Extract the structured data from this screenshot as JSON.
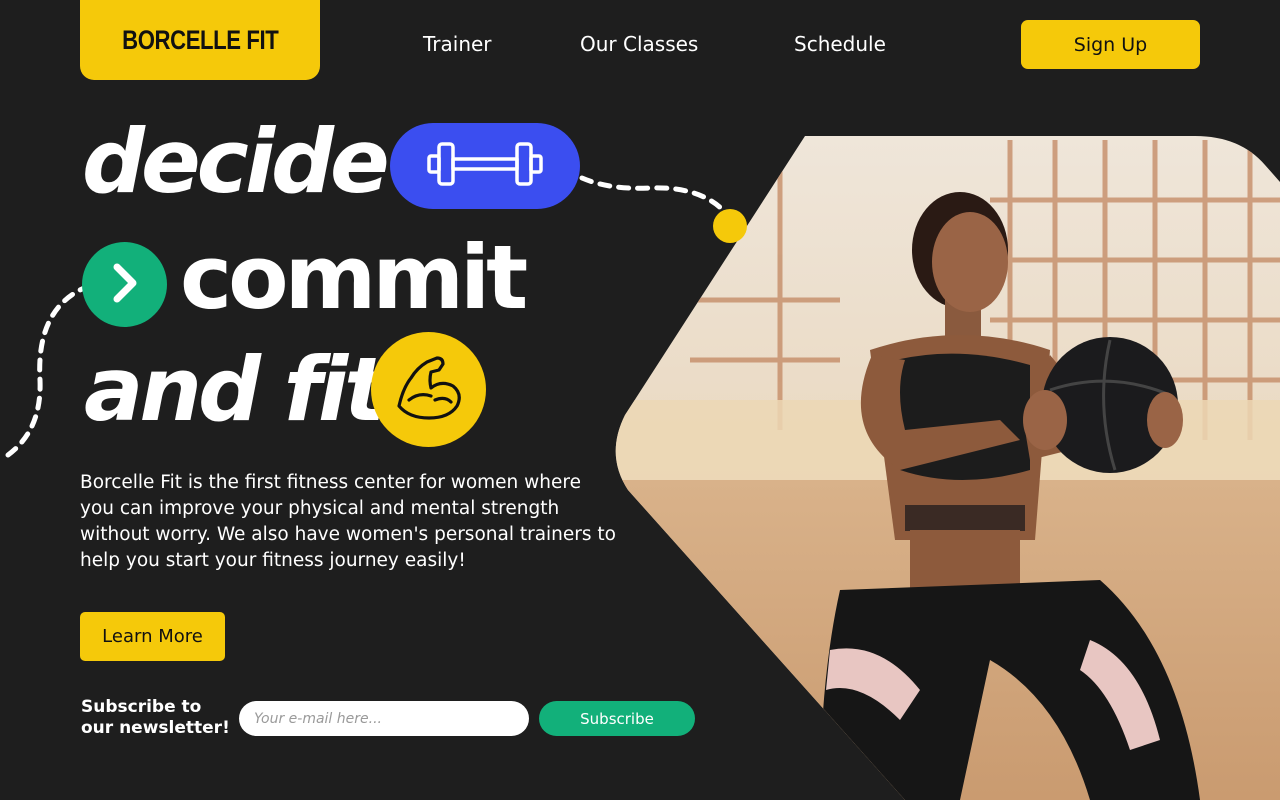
{
  "brand": {
    "name": "BORCELLE FIT"
  },
  "nav": {
    "links": [
      "Trainer",
      "Our Classes",
      "Schedule"
    ],
    "signup_label": "Sign Up"
  },
  "hero": {
    "line1": "decide",
    "line2": "commit",
    "line3": "and fit",
    "description": "Borcelle Fit is the first fitness center for women where you can improve your physical and mental strength without worry. We also have women's personal trainers to help you start your fitness journey easily!",
    "learn_more_label": "Learn More"
  },
  "newsletter": {
    "label_line1": "Subscribe to",
    "label_line2": "our newsletter!",
    "email_placeholder": "Your e-mail here...",
    "subscribe_label": "Subscribe"
  },
  "colors": {
    "background": "#1e1e1e",
    "accent_yellow": "#f5c90a",
    "accent_blue": "#3b4ef0",
    "accent_green": "#12b07a"
  },
  "icons": [
    "dumbbell-icon",
    "chevron-right-icon",
    "flexed-arm-icon"
  ]
}
